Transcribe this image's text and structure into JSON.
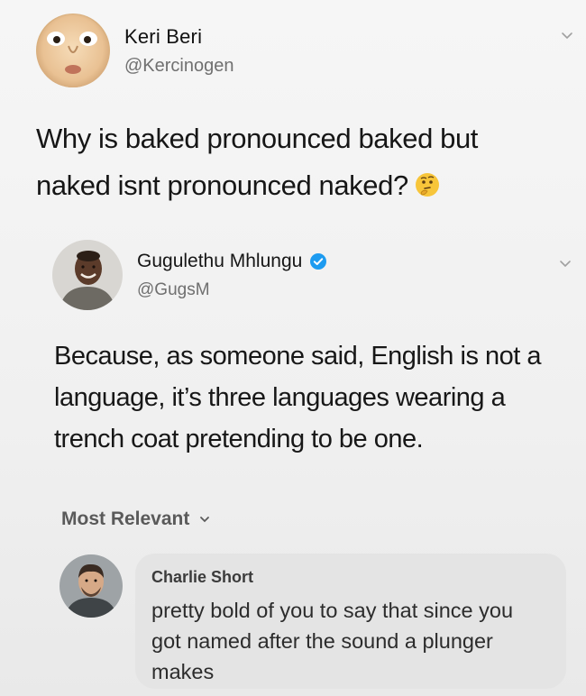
{
  "original_tweet": {
    "author_name": "Keri Beri",
    "author_handle": "@Kercinogen",
    "text": "Why is baked pronounced baked but naked isnt pronounced naked?",
    "emoji": "thinking-face-icon"
  },
  "reply_tweet": {
    "author_name": "Gugulethu Mhlungu",
    "author_handle": "@GugsM",
    "verified": true,
    "text": "Because, as someone said, English is not a language, it’s three languages wearing a trench coat pretending to be one."
  },
  "comments": {
    "sort_label": "Most Relevant",
    "items": [
      {
        "author_name": "Charlie Short",
        "text": "pretty bold of you to say that since you got named after the sound a plunger makes"
      }
    ]
  },
  "colors": {
    "background": "#f3f3f3",
    "bubble": "#e4e4e4",
    "verified_blue": "#1d9bf0",
    "handle_gray": "#707070"
  }
}
